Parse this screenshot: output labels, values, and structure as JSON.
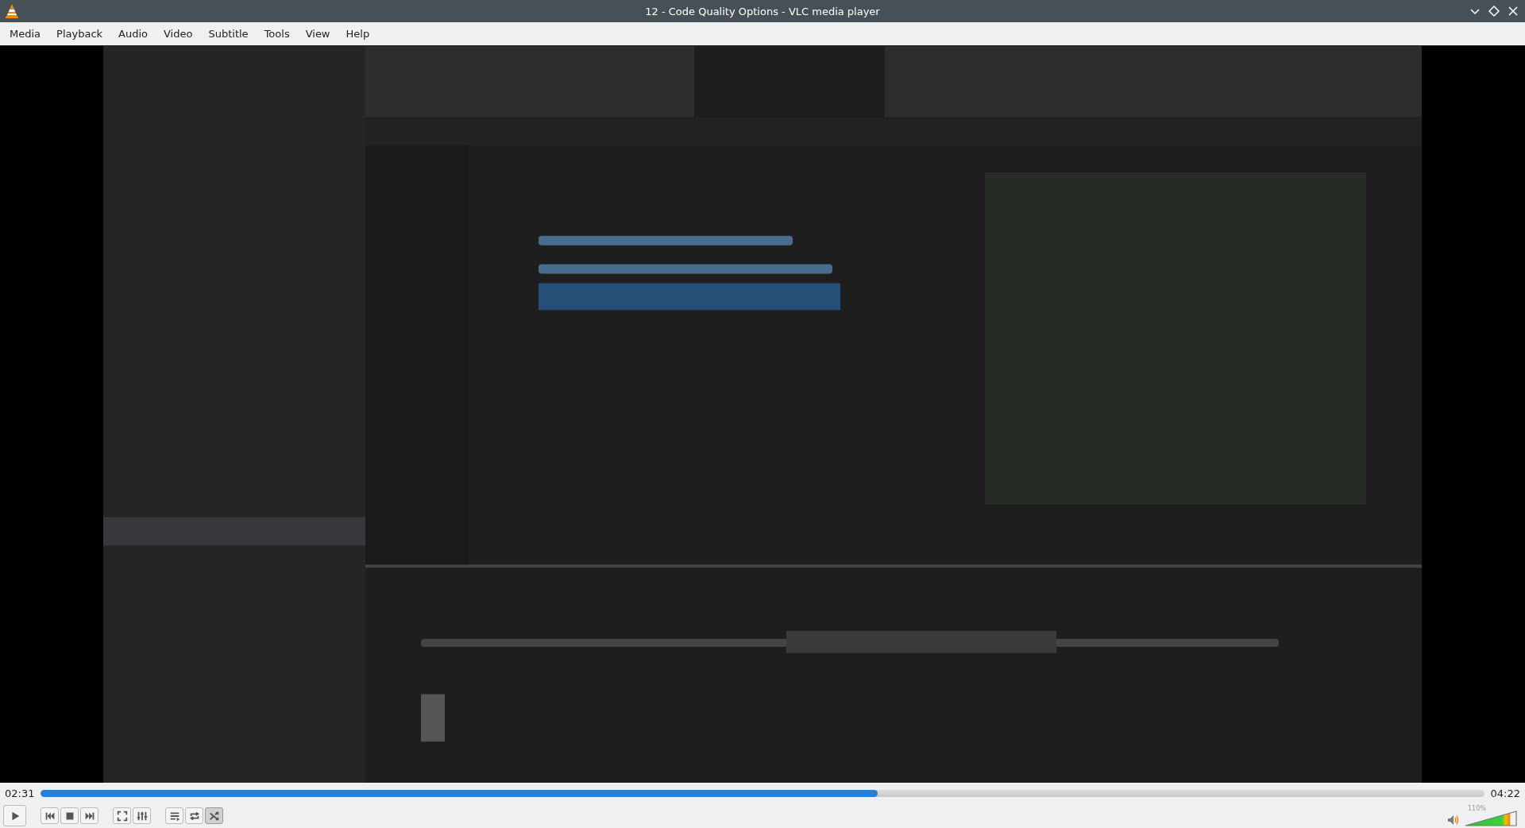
{
  "window": {
    "title": "12 - Code Quality Options - VLC media player"
  },
  "menu": [
    "Media",
    "Playback",
    "Audio",
    "Video",
    "Subtitle",
    "Tools",
    "View",
    "Help"
  ],
  "seek": {
    "elapsed": "02:31",
    "total": "04:22",
    "level": 0.58
  },
  "controls": [
    {
      "kind": "play",
      "on": false
    },
    {
      "kind": "gap"
    },
    {
      "kind": "prev",
      "on": false
    },
    {
      "kind": "stop",
      "on": false
    },
    {
      "kind": "next",
      "on": false
    },
    {
      "kind": "gap"
    },
    {
      "kind": "fullscreen",
      "on": false
    },
    {
      "kind": "effects",
      "on": false
    },
    {
      "kind": "gap"
    },
    {
      "kind": "playlist",
      "on": false
    },
    {
      "kind": "loop",
      "on": false
    },
    {
      "kind": "random",
      "on": true
    }
  ],
  "volume": {
    "reading": "110%",
    "level": 0.88
  }
}
